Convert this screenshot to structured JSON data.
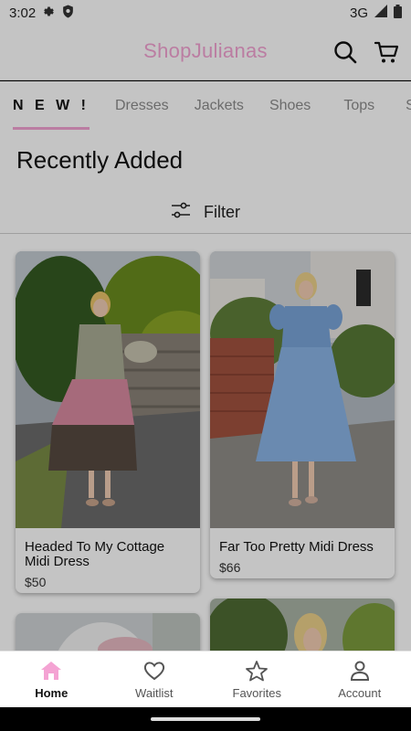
{
  "status_bar": {
    "time": "3:02",
    "network": "3G"
  },
  "app_bar": {
    "logo_text": "ShopJulianas",
    "icons": [
      "search-icon",
      "cart-icon"
    ]
  },
  "tabs": [
    {
      "label": "N E W !",
      "active": true
    },
    {
      "label": "Dresses",
      "active": false
    },
    {
      "label": "Jackets",
      "active": false
    },
    {
      "label": "Shoes",
      "active": false
    },
    {
      "label": "Tops",
      "active": false
    },
    {
      "label": "S",
      "active": false
    }
  ],
  "page": {
    "title": "Recently Added",
    "filter_label": "Filter"
  },
  "products": [
    {
      "title": "Headed To My Cottage Midi Dress",
      "price": "$50"
    },
    {
      "title": "Far Too Pretty Midi Dress",
      "price": "$66"
    }
  ],
  "bottom_nav": [
    {
      "label": "Home",
      "icon": "home-icon",
      "active": true
    },
    {
      "label": "Waitlist",
      "icon": "heart-icon",
      "active": false
    },
    {
      "label": "Favorites",
      "icon": "star-icon",
      "active": false
    },
    {
      "label": "Account",
      "icon": "account-icon",
      "active": false
    }
  ],
  "colors": {
    "brand_pink": "#f4a3d3",
    "scrim": "rgba(0,0,0,0.23)"
  }
}
